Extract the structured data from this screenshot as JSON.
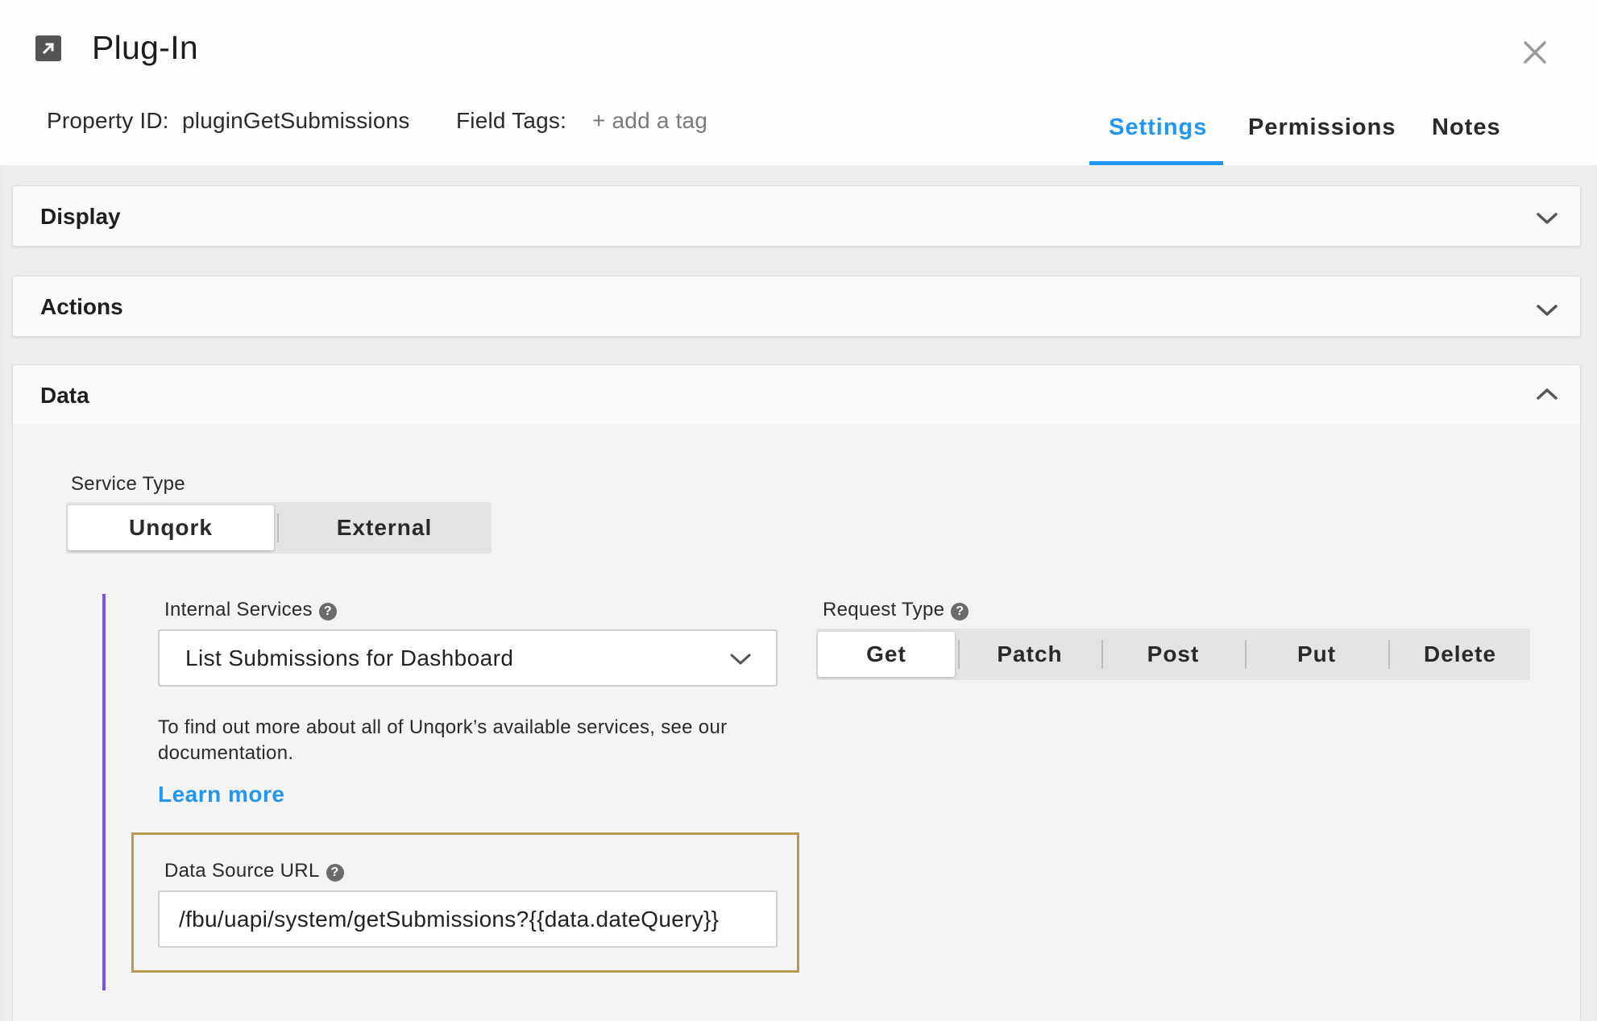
{
  "header": {
    "title": "Plug-In",
    "property_id_label": "Property ID:",
    "property_id_value": "pluginGetSubmissions",
    "field_tags_label": "Field Tags:",
    "add_tag": "+ add a tag",
    "tabs": [
      {
        "label": "Settings",
        "active": true
      },
      {
        "label": "Permissions",
        "active": false
      },
      {
        "label": "Notes",
        "active": false
      }
    ]
  },
  "panels": {
    "display": {
      "title": "Display",
      "expanded": false
    },
    "actions": {
      "title": "Actions",
      "expanded": false
    },
    "data": {
      "title": "Data",
      "expanded": true
    }
  },
  "data": {
    "service_type": {
      "label": "Service Type",
      "options": [
        "Unqork",
        "External"
      ],
      "selected": "Unqork"
    },
    "internal_services": {
      "label": "Internal Services",
      "value": "List Submissions for Dashboard"
    },
    "request_type": {
      "label": "Request Type",
      "options": [
        "Get",
        "Patch",
        "Post",
        "Put",
        "Delete"
      ],
      "selected": "Get"
    },
    "help_text": "To find out more about all of Unqork’s available services, see our documentation.",
    "learn_more": "Learn more",
    "data_source_url": {
      "label": "Data Source URL",
      "value": "/fbu/uapi/system/getSubmissions?{{data.dateQuery}}"
    }
  },
  "colors": {
    "accent": "#2196f3",
    "indicator_bar": "#7b4ff0",
    "focus_outline": "#b49a55"
  }
}
